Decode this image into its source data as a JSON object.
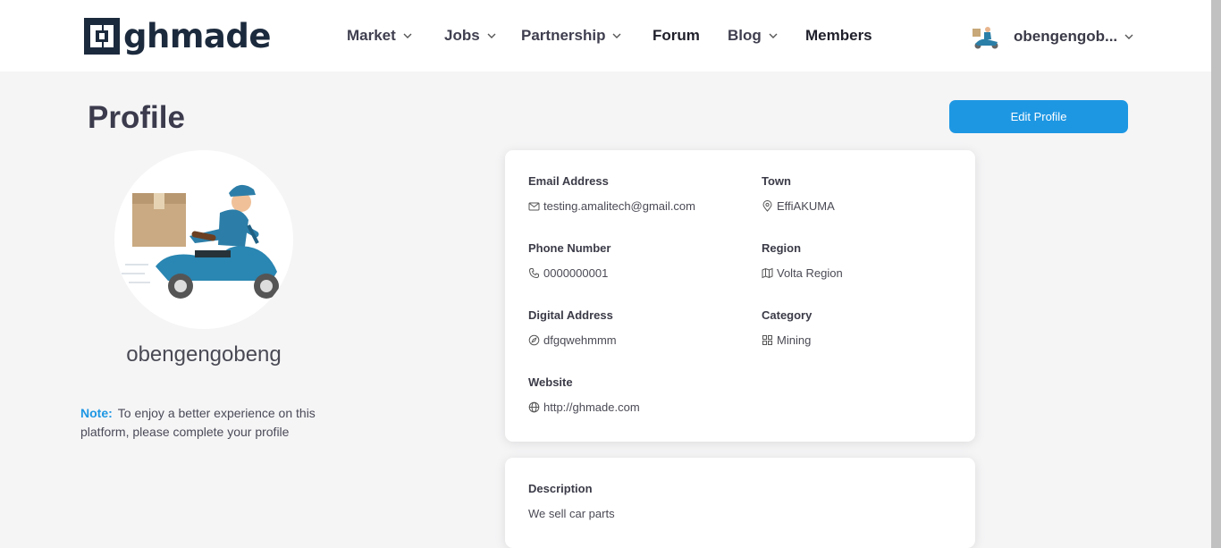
{
  "brand": {
    "logo_text": "ghmade"
  },
  "nav": {
    "market": "Market",
    "jobs": "Jobs",
    "partnership": "Partnership",
    "forum": "Forum",
    "blog": "Blog",
    "members": "Members"
  },
  "user_menu": {
    "name": "obengengob..."
  },
  "page": {
    "title": "Profile",
    "edit_button": "Edit Profile"
  },
  "profile": {
    "username": "obengengobeng",
    "note_label": "Note:",
    "note_text": "To enjoy a better experience on this platform, please complete your profile"
  },
  "details": {
    "email_label": "Email Address",
    "email_value": "testing.amalitech@gmail.com",
    "town_label": "Town",
    "town_value": "EffiAKUMA",
    "phone_label": "Phone Number",
    "phone_value": "0000000001",
    "region_label": "Region",
    "region_value": "Volta Region",
    "digital_label": "Digital Address",
    "digital_value": "dfgqwehmmm",
    "category_label": "Category",
    "category_value": "Mining",
    "website_label": "Website",
    "website_value": "http://ghmade.com"
  },
  "description": {
    "label": "Description",
    "value": "We sell car parts"
  },
  "icons": {
    "email": "envelope-icon",
    "town": "map-pin-icon",
    "phone": "phone-icon",
    "region": "map-icon",
    "digital": "compass-icon",
    "category": "grid-icon",
    "website": "globe-icon"
  },
  "colors": {
    "accent": "#1e97e3",
    "page_bg": "#f5f5f6",
    "heading": "#3b3b4d",
    "brand_dark": "#1c2a3d"
  }
}
